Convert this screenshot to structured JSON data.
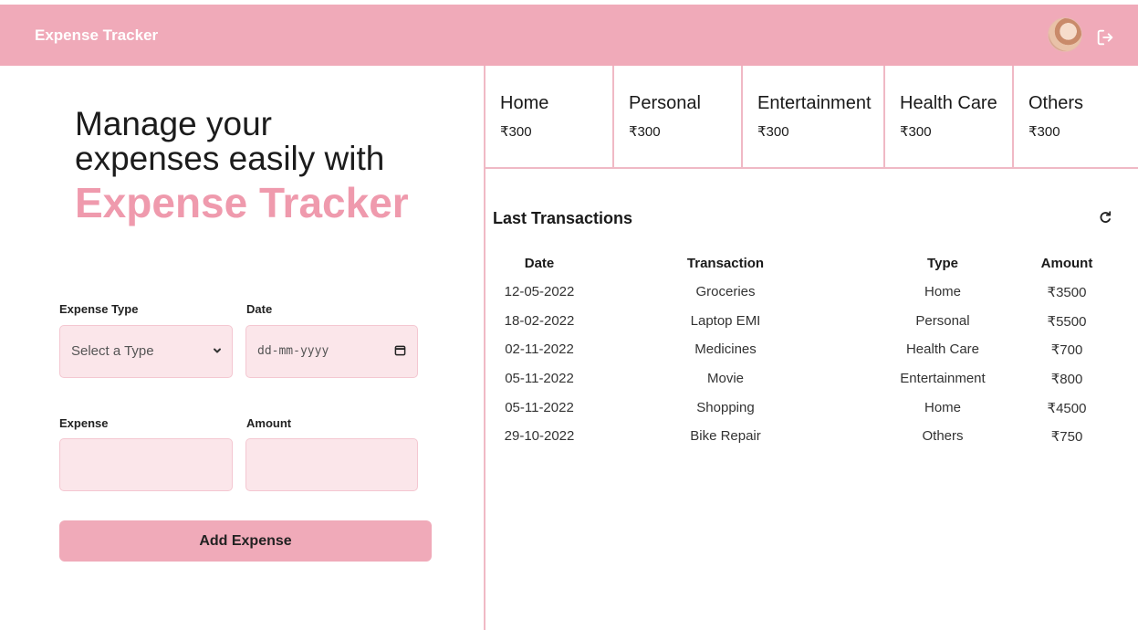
{
  "app": {
    "title": "Expense Tracker"
  },
  "hero": {
    "line1": "Manage your",
    "line2": "expenses easily with",
    "brand": "Expense Tracker"
  },
  "form": {
    "expense_type_label": "Expense Type",
    "expense_type_value": "Select a Type",
    "date_label": "Date",
    "date_placeholder": "dd-mm-yyyy",
    "expense_label": "Expense",
    "expense_value": "",
    "amount_label": "Amount",
    "amount_value": "",
    "submit_label": "Add Expense"
  },
  "categories": [
    {
      "name": "Home",
      "amount": "₹300"
    },
    {
      "name": "Personal",
      "amount": "₹300"
    },
    {
      "name": "Entertainment",
      "amount": "₹300"
    },
    {
      "name": "Health Care",
      "amount": "₹300"
    },
    {
      "name": "Others",
      "amount": "₹300"
    }
  ],
  "transactions": {
    "title": "Last Transactions",
    "headers": {
      "date": "Date",
      "transaction": "Transaction",
      "type": "Type",
      "amount": "Amount"
    },
    "rows": [
      {
        "date": "12-05-2022",
        "transaction": "Groceries",
        "type": "Home",
        "amount": "₹3500"
      },
      {
        "date": "18-02-2022",
        "transaction": "Laptop EMI",
        "type": "Personal",
        "amount": "₹5500"
      },
      {
        "date": "02-11-2022",
        "transaction": "Medicines",
        "type": "Health Care",
        "amount": "₹700"
      },
      {
        "date": "05-11-2022",
        "transaction": "Movie",
        "type": "Entertainment",
        "amount": "₹800"
      },
      {
        "date": "05-11-2022",
        "transaction": "Shopping",
        "type": "Home",
        "amount": "₹4500"
      },
      {
        "date": "29-10-2022",
        "transaction": "Bike Repair",
        "type": "Others",
        "amount": "₹750"
      }
    ]
  },
  "icons": {
    "avatar": "user-avatar",
    "logout": "logout-icon",
    "refresh": "refresh-icon",
    "chevron": "chevron-down-icon",
    "calendar": "calendar-icon"
  },
  "colors": {
    "accent": "#f0aab9",
    "brand_text": "#ef9aad",
    "input_bg": "#fbe6ea",
    "divider": "#f0b9c5"
  }
}
